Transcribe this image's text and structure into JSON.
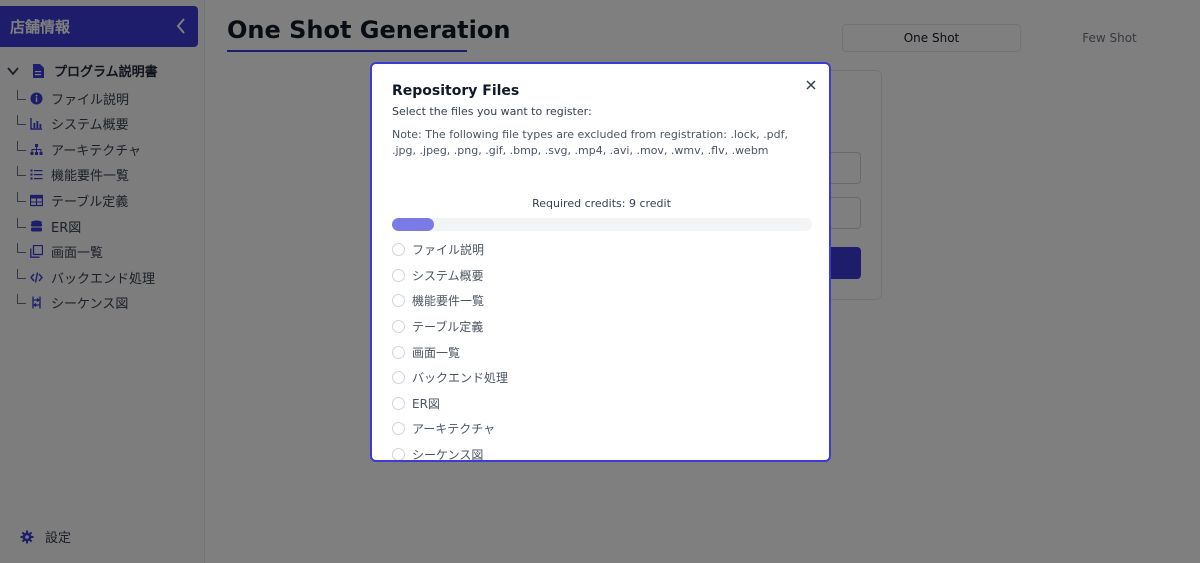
{
  "sidebar": {
    "store_name": "店舗情報",
    "root_label": "プログラム説明書",
    "items": [
      {
        "label": "ファイル説明",
        "icon": "info-icon"
      },
      {
        "label": "システム概要",
        "icon": "bar-chart-icon"
      },
      {
        "label": "アーキテクチャ",
        "icon": "sitemap-icon"
      },
      {
        "label": "機能要件一覧",
        "icon": "list-icon"
      },
      {
        "label": "テーブル定義",
        "icon": "table-icon"
      },
      {
        "label": "ER図",
        "icon": "database-icon"
      },
      {
        "label": "画面一覧",
        "icon": "copy-icon"
      },
      {
        "label": "バックエンド処理",
        "icon": "code-icon"
      },
      {
        "label": "シーケンス図",
        "icon": "sequence-icon"
      }
    ],
    "settings_label": "設定"
  },
  "main": {
    "title": "One Shot Generation",
    "tabs": [
      {
        "label": "One Shot",
        "active": true
      },
      {
        "label": "Few Shot",
        "active": false
      }
    ]
  },
  "modal": {
    "title": "Repository Files",
    "subtitle": "Select the files you want to register:",
    "note": "Note: The following file types are excluded from registration: .lock, .pdf, .jpg, .jpeg, .png, .gif, .bmp, .svg, .mp4, .avi, .mov, .wmv, .flv, .webm",
    "credits": "Required credits: 9 credit",
    "progress": 0.1,
    "files": [
      "ファイル説明",
      "システム概要",
      "機能要件一覧",
      "テーブル定義",
      "画面一覧",
      "バックエンド処理",
      "ER図",
      "アーキテクチャ",
      "シーケンス図"
    ]
  },
  "colors": {
    "accent": "#3b3bd6",
    "progress": "#7b7be8"
  }
}
